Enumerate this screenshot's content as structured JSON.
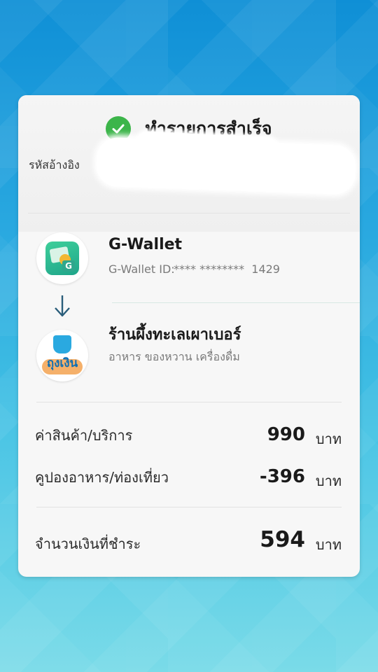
{
  "status": {
    "title": "ทำรายการสำเร็จ",
    "icon": "check-circle-icon",
    "color": "#3cb54a"
  },
  "reference": {
    "label": "รหัสอ้างอิง"
  },
  "payer": {
    "name": "G-Wallet",
    "id_label": "G-Wallet ID:",
    "id_value": "**** ********  1429",
    "icon": "g-wallet-logo-icon"
  },
  "payee": {
    "name": "ร้านผึ้งทะเลเผาเบอร์",
    "category": "อาหาร ของหวาน เครื่องดื่ม",
    "logo_text": "ถุงเงิน",
    "icon": "tung-ngern-logo-icon"
  },
  "breakdown": {
    "items": [
      {
        "label": "ค่าสินค้า/บริการ",
        "value": "990",
        "unit": "บาท"
      },
      {
        "label": "คูปองอาหาร/ท่องเที่ยว",
        "value": "-396",
        "unit": "บาท"
      }
    ],
    "total": {
      "label": "จำนวนเงินที่ชำระ",
      "value": "594",
      "unit": "บาท"
    }
  }
}
